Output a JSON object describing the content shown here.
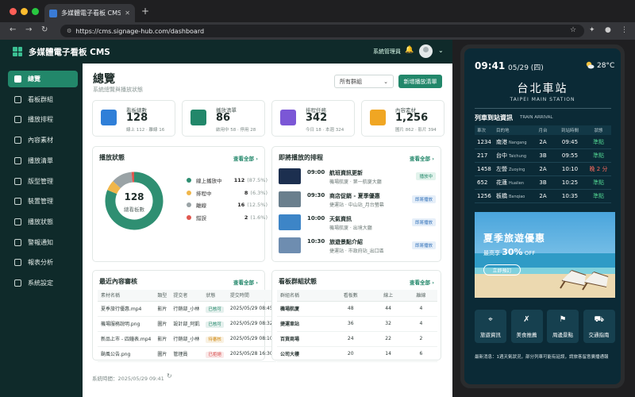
{
  "browser": {
    "tab_title": "多媒體電子看板 CMS",
    "url": "https://cms.signage-hub.com/dashboard",
    "dots": [
      "#ff5f57",
      "#febc2e",
      "#28c840"
    ]
  },
  "app": {
    "title": "多媒體電子看板 CMS",
    "admin_label": "系統管理員"
  },
  "sidebar": {
    "items": [
      {
        "label": "總覽",
        "icon": "home-icon",
        "active": true
      },
      {
        "label": "看板群組",
        "icon": "grid-icon"
      },
      {
        "label": "播放排程",
        "icon": "clock-icon"
      },
      {
        "label": "內容素材",
        "icon": "image-icon"
      },
      {
        "label": "播放清單",
        "icon": "list-icon"
      },
      {
        "label": "版型管理",
        "icon": "layout-icon"
      },
      {
        "label": "裝置管理",
        "icon": "monitor-icon"
      },
      {
        "label": "播放狀態",
        "icon": "status-icon"
      },
      {
        "label": "警報通知",
        "icon": "bell-icon"
      },
      {
        "label": "報表分析",
        "icon": "chart-icon"
      },
      {
        "label": "系統設定",
        "icon": "gear-icon"
      }
    ]
  },
  "header": {
    "title": "總覽",
    "subtitle": "系統總覽與播放狀態",
    "group_select": "所有群組",
    "new_playlist": "新增播放清單"
  },
  "stats": [
    {
      "label": "看板總數",
      "value": "128",
      "sub": "線上 112 · 離線 16",
      "icon": "monitor-icon",
      "color": "#2f7fd8"
    },
    {
      "label": "播放清單",
      "value": "86",
      "sub": "啟用中 58 · 停用 28",
      "icon": "play-icon",
      "color": "#22876a"
    },
    {
      "label": "排程任務",
      "value": "342",
      "sub": "今日 18 · 本週 324",
      "icon": "calendar-icon",
      "color": "#7b57d6"
    },
    {
      "label": "內容素材",
      "value": "1,256",
      "sub": "圖片 862 · 影片 394",
      "icon": "image-icon",
      "color": "#f0a623"
    }
  ],
  "status_card": {
    "title": "播放狀態",
    "more": "查看全部 ›",
    "total": "128",
    "total_label": "總看板數"
  },
  "chart_data": {
    "type": "pie",
    "categories": [
      "線上播放中",
      "排程中",
      "離線",
      "錯誤"
    ],
    "values": [
      112,
      8,
      16,
      2
    ],
    "percents": [
      "(87.5%)",
      "(6.3%)",
      "(12.5%)",
      "(1.6%)"
    ],
    "colors": [
      "#2f8f72",
      "#f0b64a",
      "#9aa3a6",
      "#e0574f"
    ]
  },
  "schedule_card": {
    "title": "即將播放的排程",
    "more": "查看全部 ›",
    "items": [
      {
        "time": "09:00",
        "title": "航班資訊更新",
        "loc": "機場航廈 · 第一航廈大廳",
        "badge": "播放中",
        "thumb": "#1c2f4f"
      },
      {
        "time": "09:30",
        "title": "商店促銷 - 夏季優惠",
        "loc": "捷運站 · 中山站_月台螢幕",
        "badge": "即將播放",
        "thumb": "#6a7f8d"
      },
      {
        "time": "10:00",
        "title": "天氣資訊",
        "loc": "機場航廈 · 出境大廳",
        "badge": "即將播放",
        "thumb": "#3d85c7"
      },
      {
        "time": "10:30",
        "title": "旅遊景點介紹",
        "loc": "捷運站 · 市政府站_出口區",
        "badge": "即將播放",
        "thumb": "#6e8db0"
      }
    ]
  },
  "review_card": {
    "title": "最近內容審核",
    "more": "查看全部 ›",
    "headers": [
      "素材名稱",
      "類型",
      "提交者",
      "狀態",
      "提交時間"
    ],
    "rows": [
      [
        "夏季旅行優惠.mp4",
        "影片",
        "行銷部_小林",
        "已核可",
        "2025/05/29 08:45"
      ],
      [
        "機場服務說明.png",
        "圖片",
        "設計部_阿凱",
        "已核可",
        "2025/05/29 08:32"
      ],
      [
        "新品上市 - 四鐘表.mp4",
        "影片",
        "行銷部_小林",
        "待審核",
        "2025/05/29 08:10"
      ],
      [
        "颱風公告.png",
        "圖片",
        "管理員",
        "已拒絕",
        "2025/05/28 16:30"
      ]
    ],
    "status_colors": {
      "已核可": "#22876a",
      "待審核": "#d08a14",
      "已拒絕": "#d64545"
    }
  },
  "group_card": {
    "title": "看板群組狀態",
    "more": "查看全部 ›",
    "headers": [
      "群組名稱",
      "看板數",
      "線上",
      "離線"
    ],
    "rows": [
      [
        "機場航廈",
        "48",
        "44",
        "4"
      ],
      [
        "捷運車站",
        "36",
        "32",
        "4"
      ],
      [
        "百貨商場",
        "24",
        "22",
        "2"
      ],
      [
        "公司大樓",
        "20",
        "14",
        "6"
      ]
    ]
  },
  "footer": {
    "label": "系統時間：",
    "time": "2025/05/29 09:41"
  },
  "kiosk": {
    "time": "09:41",
    "date": "05/29 (四)",
    "temp": "28°C",
    "station": "台北車站",
    "station_en": "TAIPEI MAIN STATION",
    "section": "列車到站資訊",
    "section_en": "TRAIN ARRIVAL",
    "headers": [
      "車次",
      "目的地",
      "月台",
      "到站時間",
      "狀態"
    ],
    "trains": [
      {
        "no": "1234",
        "dest": "南港",
        "dest_en": "Nangang",
        "plat": "2A",
        "time": "09:45",
        "status": "準點",
        "late": false
      },
      {
        "no": "217",
        "dest": "台中",
        "dest_en": "Taichung",
        "plat": "3B",
        "time": "09:55",
        "status": "準點",
        "late": false
      },
      {
        "no": "1458",
        "dest": "左營",
        "dest_en": "Zuoying",
        "plat": "2A",
        "time": "10:10",
        "status": "晚 2 分",
        "late": true
      },
      {
        "no": "652",
        "dest": "花蓮",
        "dest_en": "Hualien",
        "plat": "3B",
        "time": "10:25",
        "status": "準點",
        "late": false
      },
      {
        "no": "1256",
        "dest": "板橋",
        "dest_en": "Banqiao",
        "plat": "2A",
        "time": "10:35",
        "status": "準點",
        "late": false
      }
    ],
    "promo_title": "夏季旅遊優惠",
    "promo_prefix": "最高享",
    "promo_pct": "30%",
    "promo_off": "OFF",
    "promo_btn": "立即預訂",
    "quick": [
      {
        "label": "旅遊資訊",
        "icon": "pin-icon"
      },
      {
        "label": "美食推薦",
        "icon": "food-icon"
      },
      {
        "label": "周邊景點",
        "icon": "map-icon"
      },
      {
        "label": "交通指南",
        "icon": "car-icon"
      }
    ],
    "ticker": "最新消息：1週天氣狀況，部分列車可能有延誤，請旅客留意廣播通報"
  }
}
